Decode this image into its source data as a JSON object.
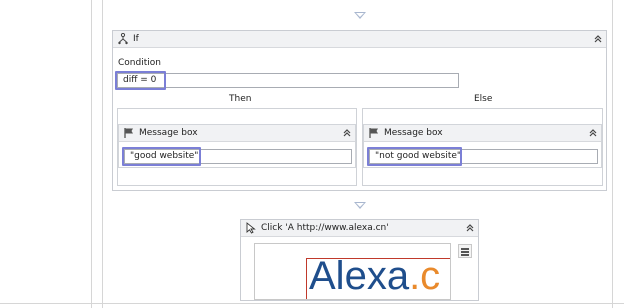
{
  "if_activity": {
    "title": "If",
    "condition_label": "Condition",
    "condition_value": "diff = 0",
    "then_label": "Then",
    "else_label": "Else"
  },
  "then_message_box": {
    "title": "Message box",
    "text_value": "\"good website\""
  },
  "else_message_box": {
    "title": "Message box",
    "text_value": "\"not good website\""
  },
  "click_activity": {
    "title": "Click 'A  http://www.alexa.cn'",
    "preview_logo_text": "Alexa.c"
  },
  "colors": {
    "header_bg": "#f1f2f4",
    "highlight": "#7b7fd6",
    "arrow": "#a9b7cf",
    "alexa_blue": "#1f4e8c",
    "alexa_orange": "#e98a2c",
    "preview_border": "#c0392b"
  },
  "icons": {
    "if": "branch-icon",
    "message_box": "flag-icon",
    "click": "mouse-pointer-icon",
    "collapse": "double-chevron-up-icon",
    "list": "hamburger-menu-icon",
    "connector": "down-triangle-icon"
  }
}
